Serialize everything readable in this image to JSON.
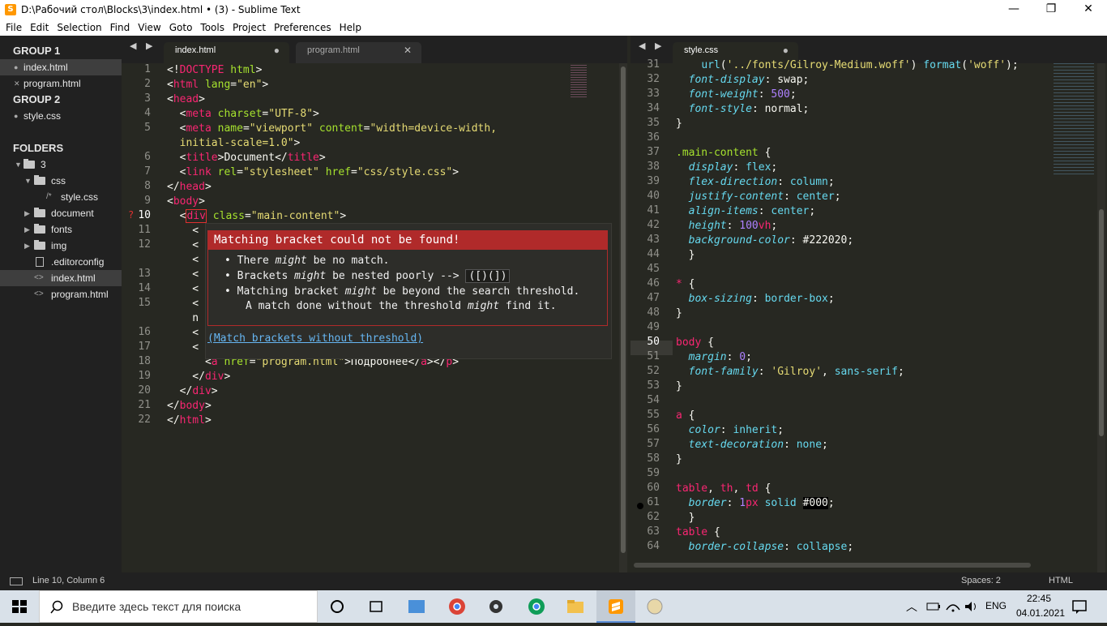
{
  "window": {
    "title": "D:\\Рабочий стол\\Blocks\\3\\index.html • (3) - Sublime Text",
    "minimize": "—",
    "maximize": "❐",
    "close": "✕"
  },
  "menu": [
    "File",
    "Edit",
    "Selection",
    "Find",
    "View",
    "Goto",
    "Tools",
    "Project",
    "Preferences",
    "Help"
  ],
  "sidebar": {
    "group1": "GROUP 1",
    "group1_items": [
      {
        "label": "index.html",
        "mark": "●"
      },
      {
        "label": "program.html",
        "mark": "✕"
      }
    ],
    "group2": "GROUP 2",
    "group2_items": [
      {
        "label": "style.css",
        "mark": "●"
      }
    ],
    "folders_title": "FOLDERS",
    "tree": [
      "3",
      "css",
      "style.css",
      "document",
      "fonts",
      "img",
      ".editorconfig",
      "index.html",
      "program.html"
    ]
  },
  "left_tabs": [
    {
      "label": "index.html",
      "mark": "●"
    },
    {
      "label": "program.html",
      "mark": "✕"
    }
  ],
  "right_tabs": [
    {
      "label": "style.css",
      "mark": "●"
    }
  ],
  "left_nav": "◀ ▶",
  "right_nav": "◀ ▶",
  "left_lines": [
    "1",
    "2",
    "3",
    "4",
    "5",
    "",
    "6",
    "7",
    "8",
    "9",
    "10",
    "11",
    "12",
    "",
    "13",
    "14",
    "15",
    "",
    "16",
    "17",
    "18",
    "19",
    "20",
    "21",
    "22"
  ],
  "error_marker": "?",
  "popup": {
    "title": "Matching bracket could not be found!",
    "b1a": "There ",
    "b1b": "might",
    "b1c": " be no match.",
    "b2a": "Brackets ",
    "b2b": "might",
    "b2c": " be nested poorly --> ",
    "b2code": "([)(])",
    "b3a": "Matching bracket ",
    "b3b": "might",
    "b3c": " be beyond the search threshold.",
    "b4a": "A match done without the threshold ",
    "b4b": "might",
    "b4c": " find it.",
    "link": "(Match brackets without threshold)",
    "bullet": "•"
  },
  "right_lines": [
    "31",
    "32",
    "33",
    "34",
    "35",
    "36",
    "37",
    "38",
    "39",
    "40",
    "41",
    "42",
    "43",
    "44",
    "45",
    "46",
    "47",
    "48",
    "49",
    "50",
    "51",
    "52",
    "53",
    "54",
    "55",
    "56",
    "57",
    "58",
    "59",
    "60",
    "61",
    "62",
    "63",
    "64"
  ],
  "status": {
    "position": "Line 10, Column 6",
    "spaces": "Spaces: 2",
    "syntax": "HTML"
  },
  "taskbar": {
    "search_placeholder": "Введите здесь текст для поиска",
    "lang": "ENG",
    "time": "22:45",
    "date": "04.01.2021"
  },
  "colors": {
    "tag": "#f92672",
    "attr": "#a6e22e",
    "string": "#e6db74",
    "property": "#66d9ef",
    "number": "#ae81ff",
    "error": "#b02a2a"
  }
}
